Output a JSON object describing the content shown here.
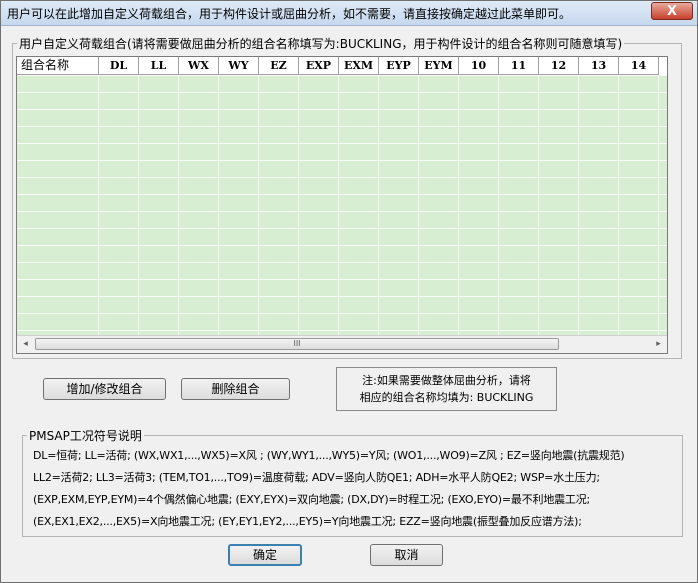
{
  "window": {
    "title": "用户可以在此增加自定义荷载组合，用于构件设计或屈曲分析，如不需要，请直接按确定越过此菜单即可。",
    "close_label": "X"
  },
  "combo_group": {
    "legend": "用户自定义荷载组合(请将需要做屈曲分析的组合名称填写为:BUCKLING，用于构件设计的组合名称则可随意填写)",
    "columns": [
      "组合名称",
      "DL",
      "LL",
      "WX",
      "WY",
      "EZ",
      "EXP",
      "EXM",
      "EYP",
      "EYM",
      "10",
      "11",
      "12",
      "13",
      "14"
    ],
    "scroll_left": "◂",
    "scroll_right": "▸",
    "scroll_grip": "III"
  },
  "actions": {
    "add_modify_label": "增加/修改组合",
    "delete_label": "删除组合"
  },
  "note": {
    "line1": "注:如果需要做整体屈曲分析，请将",
    "line2": "相应的组合名称均填为: BUCKLING"
  },
  "symbols_group": {
    "legend": "PMSAP工况符号说明",
    "lines": [
      "DL=恒荷;  LL=活荷;  (WX,WX1,...,WX5)=X风 ;   (WY,WY1,...,WY5)=Y风;   (WO1,...,WO9)=Z风 ; EZ=竖向地震(抗震规范)",
      "LL2=活荷2;   LL3=活荷3;   (TEM,TO1,...,TO9)=温度荷载;  ADV=竖向人防QE1;   ADH=水平人防QE2;   WSP=水土压力;",
      "(EXP,EXM,EYP,EYM)=4个偶然偏心地震;   (EXY,EYX)=双向地震;   (DX,DY)=时程工况;   (EXO,EYO)=最不利地震工况;",
      "(EX,EX1,EX2,...,EX5)=X向地震工况;  (EY,EY1,EY2,...,EY5)=Y向地震工况; EZZ=竖向地震(振型叠加反应谱方法);"
    ]
  },
  "footer": {
    "ok_label": "确定",
    "cancel_label": "取消"
  }
}
